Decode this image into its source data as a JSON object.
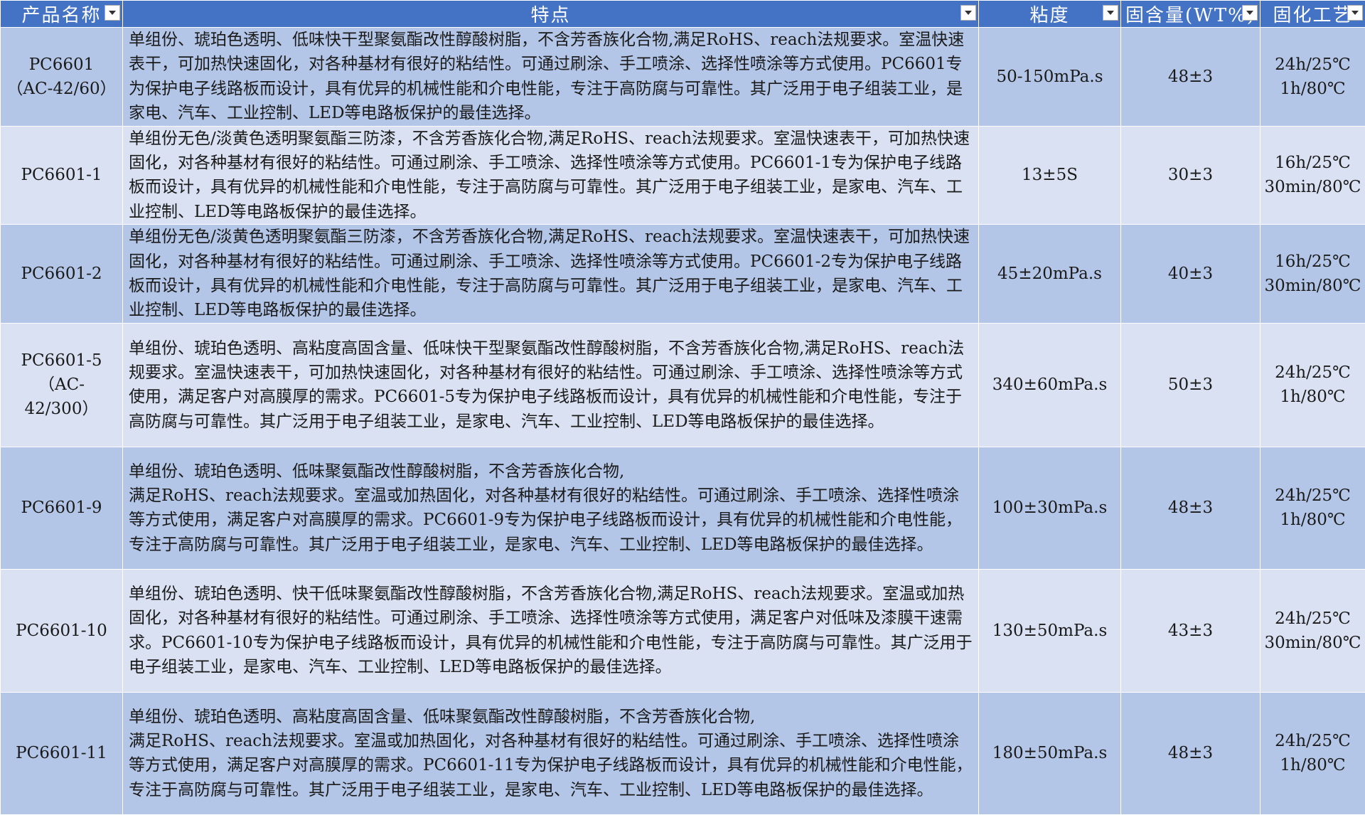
{
  "headers": {
    "name": "产品名称",
    "features": "特点",
    "viscosity": "粘度",
    "solid": "固含量(WT%)",
    "cure": "固化工艺"
  },
  "rows": [
    {
      "name": "PC6601\n（AC-42/60）",
      "desc": "单组份、琥珀色透明、低味快干型聚氨酯改性醇酸树脂，不含芳香族化合物,满足RoHS、reach法规要求。室温快速表干，可加热快速固化，对各种基材有很好的粘结性。可通过刷涂、手工喷涂、选择性喷涂等方式使用。PC6601专为保护电子线路板而设计，具有优异的机械性能和介电性能，专注于高防腐与可靠性。其广泛用于电子组装工业，是家电、汽车、工业控制、LED等电路板保护的最佳选择。",
      "viscosity": "50-150mPa.s",
      "solid": "48±3",
      "cure": "24h/25℃\n1h/80℃"
    },
    {
      "name": "PC6601-1",
      "desc": "单组份无色/淡黄色透明聚氨酯三防漆，不含芳香族化合物,满足RoHS、reach法规要求。室温快速表干，可加热快速固化，对各种基材有很好的粘结性。可通过刷涂、手工喷涂、选择性喷涂等方式使用。PC6601-1专为保护电子线路板而设计，具有优异的机械性能和介电性能，专注于高防腐与可靠性。其广泛用于电子组装工业，是家电、汽车、工业控制、LED等电路板保护的最佳选择。",
      "viscosity": "13±5S",
      "solid": "30±3",
      "cure": "16h/25℃\n30min/80℃"
    },
    {
      "name": "PC6601-2",
      "desc": "单组份无色/淡黄色透明聚氨酯三防漆，不含芳香族化合物,满足RoHS、reach法规要求。室温快速表干，可加热快速固化，对各种基材有很好的粘结性。可通过刷涂、手工喷涂、选择性喷涂等方式使用。PC6601-2专为保护电子线路板而设计，具有优异的机械性能和介电性能，专注于高防腐与可靠性。其广泛用于电子组装工业，是家电、汽车、工业控制、LED等电路板保护的最佳选择。",
      "viscosity": "45±20mPa.s",
      "solid": "40±3",
      "cure": "16h/25℃\n30min/80℃"
    },
    {
      "name": "PC6601-5\n（AC-\n42/300）",
      "desc": "单组份、琥珀色透明、高粘度高固含量、低味快干型聚氨酯改性醇酸树脂，不含芳香族化合物,满足RoHS、reach法规要求。室温快速表干，可加热快速固化，对各种基材有很好的粘结性。可通过刷涂、手工喷涂、选择性喷涂等方式使用，满足客户对高膜厚的需求。PC6601-5专为保护电子线路板而设计，具有优异的机械性能和介电性能，专注于高防腐与可靠性。其广泛用于电子组装工业，是家电、汽车、工业控制、LED等电路板保护的最佳选择。",
      "viscosity": "340±60mPa.s",
      "solid": "50±3",
      "cure": "24h/25℃\n1h/80℃"
    },
    {
      "name": "PC6601-9",
      "desc": "单组份、琥珀色透明、低味聚氨酯改性醇酸树脂，不含芳香族化合物,\n满足RoHS、reach法规要求。室温或加热固化，对各种基材有很好的粘结性。可通过刷涂、手工喷涂、选择性喷涂等方式使用，满足客户对高膜厚的需求。PC6601-9专为保护电子线路板而设计，具有优异的机械性能和介电性能，专注于高防腐与可靠性。其广泛用于电子组装工业，是家电、汽车、工业控制、LED等电路板保护的最佳选择。",
      "viscosity": "100±30mPa.s",
      "solid": "48±3",
      "cure": "24h/25℃\n1h/80℃"
    },
    {
      "name": "PC6601-10",
      "desc": "单组份、琥珀色透明、快干低味聚氨酯改性醇酸树脂，不含芳香族化合物,满足RoHS、reach法规要求。室温或加热固化，对各种基材有很好的粘结性。可通过刷涂、手工喷涂、选择性喷涂等方式使用，满足客户对低味及漆膜干速需求。PC6601-10专为保护电子线路板而设计，具有优异的机械性能和介电性能，专注于高防腐与可靠性。其广泛用于电子组装工业，是家电、汽车、工业控制、LED等电路板保护的最佳选择。",
      "viscosity": "130±50mPa.s",
      "solid": "43±3",
      "cure": "24h/25℃\n30min/80℃"
    },
    {
      "name": "PC6601-11",
      "desc": "单组份、琥珀色透明、高粘度高固含量、低味聚氨酯改性醇酸树脂，不含芳香族化合物,\n满足RoHS、reach法规要求。室温或加热固化，对各种基材有很好的粘结性。可通过刷涂、手工喷涂、选择性喷涂等方式使用，满足客户对高膜厚的需求。PC6601-11专为保护电子线路板而设计，具有优异的机械性能和介电性能，专注于高防腐与可靠性。其广泛用于电子组装工业，是家电、汽车、工业控制、LED等电路板保护的最佳选择。",
      "viscosity": "180±50mPa.s",
      "solid": "48±3",
      "cure": "24h/25℃\n1h/80℃"
    }
  ],
  "colors": {
    "header_bg": "#4472c4",
    "row_dark": "#b4c6e7",
    "row_light": "#d9e1f2"
  },
  "icons": {
    "filter": "filter-dropdown-icon"
  }
}
